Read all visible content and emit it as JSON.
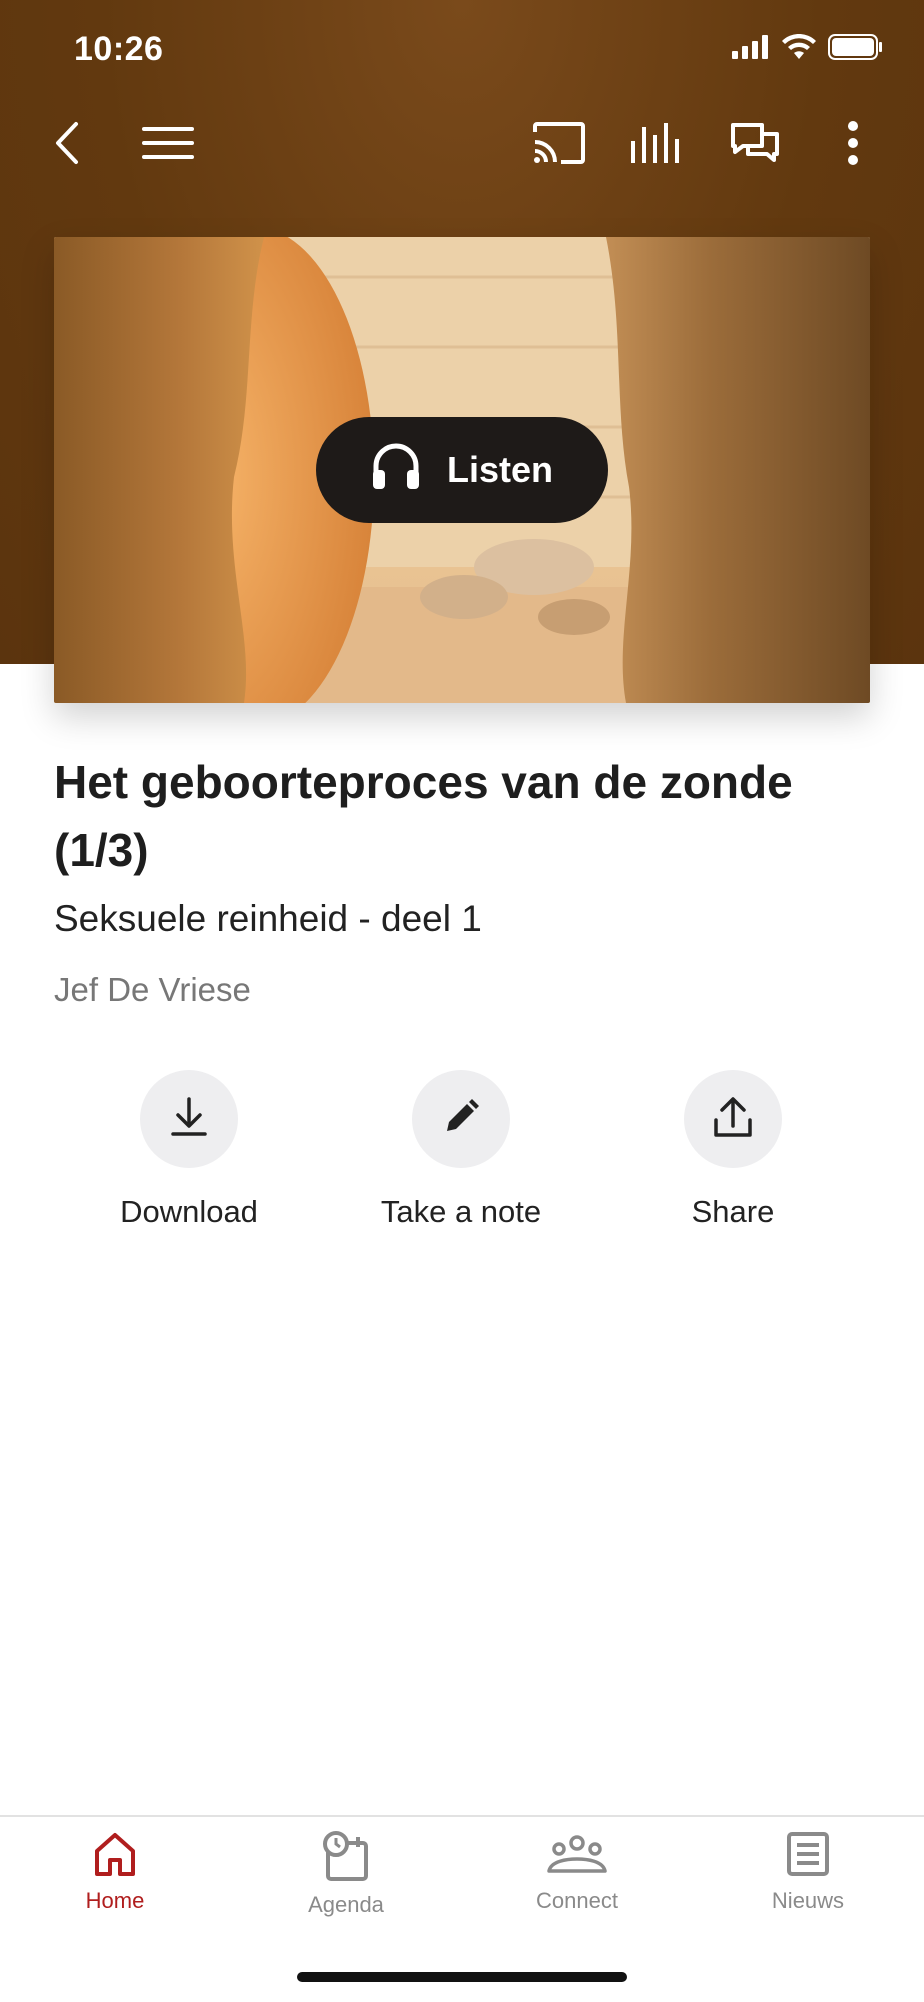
{
  "status_bar": {
    "time": "10:26"
  },
  "toolbar": {
    "icons": [
      "back-icon",
      "menu-icon",
      "cast-icon",
      "equalizer-icon",
      "chat-icon",
      "more-vertical-icon"
    ]
  },
  "hero": {
    "listen_label": "Listen",
    "icon": "headphones-icon"
  },
  "content": {
    "title": "Het geboorteproces van de zonde (1/3)",
    "subtitle": "Seksuele reinheid - deel 1",
    "author": "Jef De Vriese"
  },
  "actions": [
    {
      "label": "Download",
      "icon": "download-icon"
    },
    {
      "label": "Take a note",
      "icon": "pencil-icon"
    },
    {
      "label": "Share",
      "icon": "share-icon"
    }
  ],
  "tabbar": {
    "tabs": [
      {
        "label": "Home",
        "icon": "home-icon",
        "active": true
      },
      {
        "label": "Agenda",
        "icon": "agenda-icon",
        "active": false
      },
      {
        "label": "Connect",
        "icon": "people-icon",
        "active": false
      },
      {
        "label": "Nieuws",
        "icon": "news-icon",
        "active": false
      }
    ]
  },
  "colors": {
    "header": "#62390f",
    "accent": "#b01e1e",
    "inactive": "#8a8a8a"
  }
}
